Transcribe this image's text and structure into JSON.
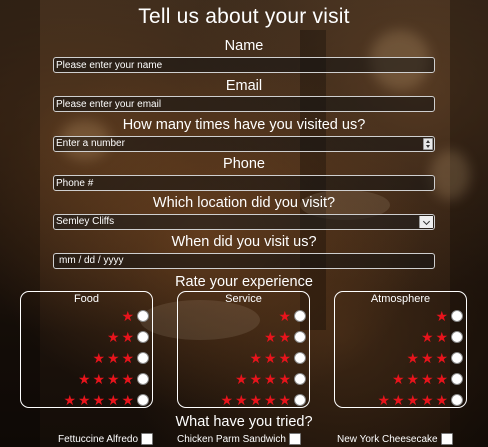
{
  "form": {
    "title": "Tell us about your visit",
    "name": {
      "label": "Name",
      "placeholder": "Please enter your name"
    },
    "email": {
      "label": "Email",
      "placeholder": "Please enter your email"
    },
    "visits": {
      "label": "How many times have you visited us?",
      "placeholder": "Enter a number"
    },
    "phone": {
      "label": "Phone",
      "placeholder": "Phone #"
    },
    "location": {
      "label": "Which location did you visit?",
      "selected": "Semley Cliffs"
    },
    "date": {
      "label": "When did you visit us?",
      "placeholder": "mm / dd / yyyy"
    },
    "rating": {
      "label": "Rate your experience",
      "star_glyph": "★",
      "star_color": "#e8141c",
      "categories": [
        {
          "title": "Food",
          "options": [
            1,
            2,
            3,
            4,
            5
          ],
          "selected": null
        },
        {
          "title": "Service",
          "options": [
            1,
            2,
            3,
            4,
            5
          ],
          "selected": null
        },
        {
          "title": "Atmosphere",
          "options": [
            1,
            2,
            3,
            4,
            5
          ],
          "selected": null
        }
      ]
    },
    "tried": {
      "label": "What have you tried?",
      "items": [
        {
          "label": "Fettuccine Alfredo",
          "checked": false
        },
        {
          "label": "Chicken Parm Sandwich",
          "checked": false
        },
        {
          "label": "New York Cheesecake",
          "checked": false
        }
      ]
    }
  }
}
